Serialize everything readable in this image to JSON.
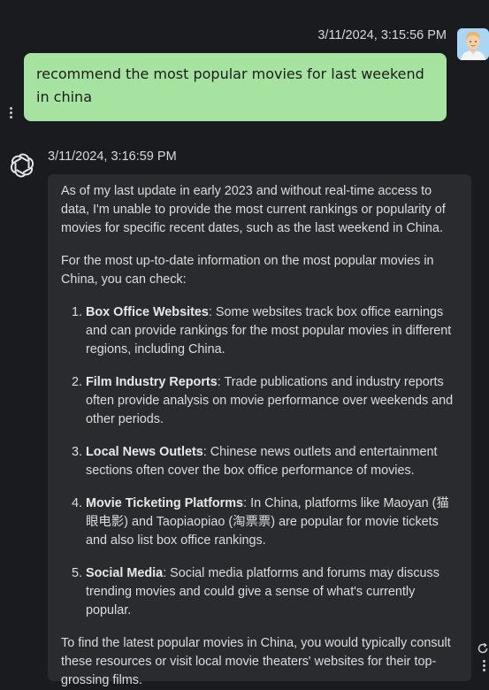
{
  "user_message": {
    "timestamp": "3/11/2024, 3:15:56 PM",
    "text": "recommend the most popular movies for last weekend in china",
    "avatar_icon": "user-avatar-icon"
  },
  "assistant_message": {
    "timestamp": "3/11/2024, 3:16:59 PM",
    "logo_icon": "openai-logo-icon",
    "intro": "As of my last update in early 2023 and without real-time access to data, I'm unable to provide the most current rankings or popularity of movies for specific recent dates, such as the last weekend in China.",
    "lead": "For the most up-to-date information on the most popular movies in China, you can check:",
    "items": [
      {
        "title": "Box Office Websites",
        "text": ": Some websites track box office earnings and can provide rankings for the most popular movies in different regions, including China."
      },
      {
        "title": "Film Industry Reports",
        "text": ": Trade publications and industry reports often provide analysis on movie performance over weekends and other periods."
      },
      {
        "title": "Local News Outlets",
        "text": ": Chinese news outlets and entertainment sections often cover the box office performance of movies."
      },
      {
        "title": "Movie Ticketing Platforms",
        "text": ": In China, platforms like Maoyan (猫眼电影) and Taopiaopiao (淘票票) are popular for movie tickets and also list box office rankings."
      },
      {
        "title": "Social Media",
        "text": ": Social media platforms and forums may discuss trending movies and could give a sense of what's currently popular."
      }
    ],
    "outro": "To find the latest popular movies in China, you would typically consult these resources or visit local movie theaters' websites for their top-grossing films."
  },
  "colors": {
    "background": "#1a1b1f",
    "user_bubble": "#a6e3a1",
    "assistant_bubble": "#2a2b2e"
  }
}
